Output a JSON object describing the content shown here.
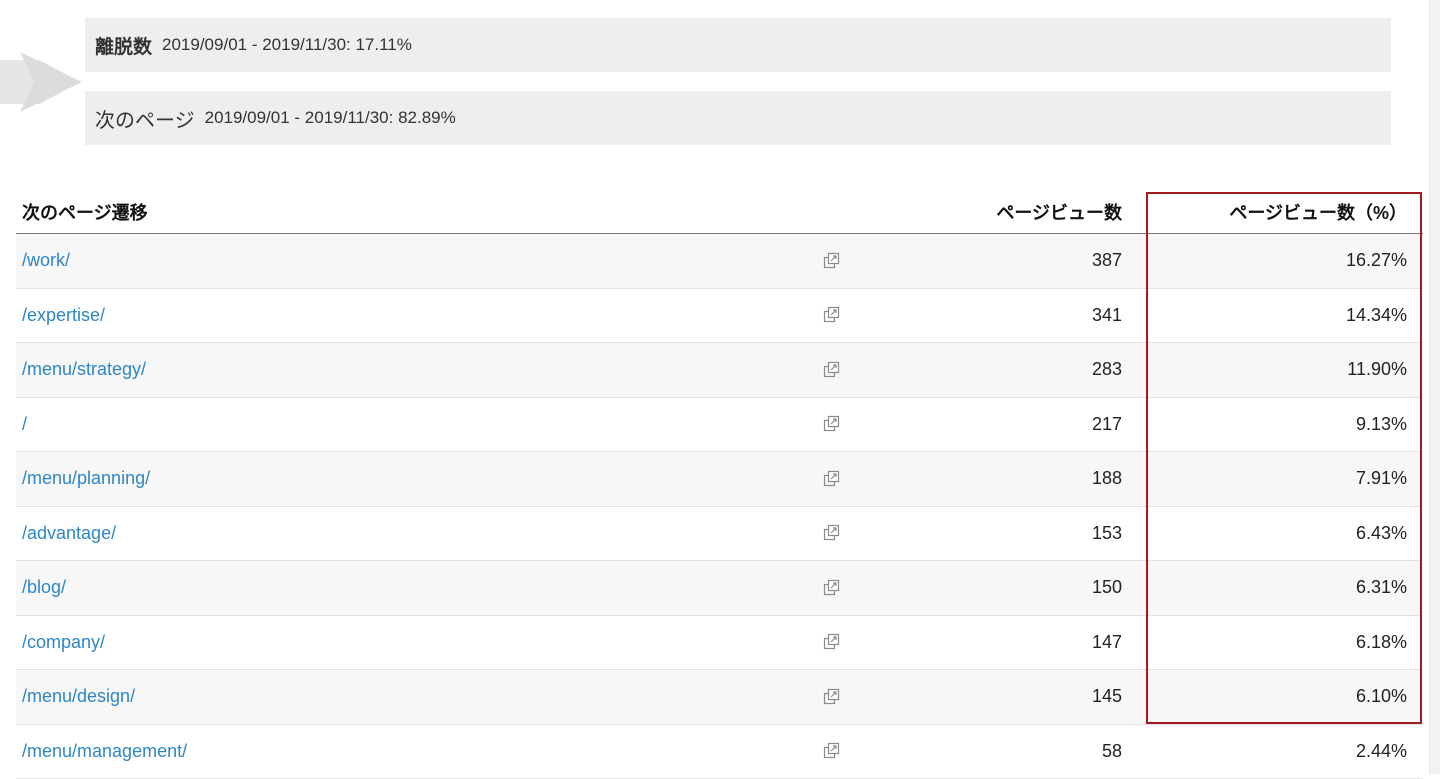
{
  "flow": {
    "exit": {
      "label": "離脱数",
      "value": "2019/09/01 - 2019/11/30: 17.11%"
    },
    "next": {
      "label": "次のページ",
      "value": "2019/09/01 - 2019/11/30: 82.89%"
    }
  },
  "table": {
    "headers": {
      "page": "次のページ遷移",
      "views": "ページビュー数",
      "pct": "ページビュー数（%）"
    },
    "rows": [
      {
        "page": "/work/",
        "views": "387",
        "pct": "16.27%"
      },
      {
        "page": "/expertise/",
        "views": "341",
        "pct": "14.34%"
      },
      {
        "page": "/menu/strategy/",
        "views": "283",
        "pct": "11.90%"
      },
      {
        "page": "/",
        "views": "217",
        "pct": "9.13%"
      },
      {
        "page": "/menu/planning/",
        "views": "188",
        "pct": "7.91%"
      },
      {
        "page": "/advantage/",
        "views": "153",
        "pct": "6.43%"
      },
      {
        "page": "/blog/",
        "views": "150",
        "pct": "6.31%"
      },
      {
        "page": "/company/",
        "views": "147",
        "pct": "6.18%"
      },
      {
        "page": "/menu/design/",
        "views": "145",
        "pct": "6.10%"
      },
      {
        "page": "/menu/management/",
        "views": "58",
        "pct": "2.44%"
      }
    ],
    "row_icon": "external-link-icon"
  },
  "colors": {
    "link": "#2e86c7",
    "highlight": "#a31b1f",
    "box_bg": "#eeeeee"
  }
}
